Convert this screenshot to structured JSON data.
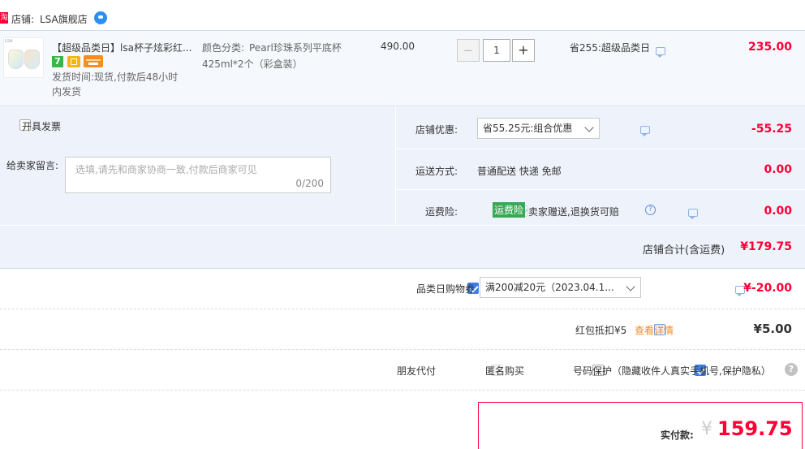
{
  "store": {
    "prefix": "店铺:",
    "name": "LSA旗舰店",
    "badge": "淘"
  },
  "item": {
    "title": "【超级品类日】lsa杯子炫彩红...",
    "sku_label": "颜色分类:",
    "sku_value_1": "Pearl珍珠系列平底杯",
    "sku_value_2": "425ml*2个（彩盒装）",
    "ship_time_1": "发货时间:现货,付款后48小时",
    "ship_time_2": "内发货",
    "price": "490.00",
    "qty": "1",
    "minus": "−",
    "plus": "+",
    "promo": "省255:超级品类日",
    "subtotal": "235.00",
    "thumb_logo": "LSA",
    "tag_seven": "7"
  },
  "invoice": {
    "label": "开具发票"
  },
  "remark": {
    "label": "给卖家留言:",
    "placeholder": "选填,请先和商家协商一致,付款后商家可见",
    "counter": "0/200"
  },
  "discount": {
    "label": "店铺优惠:",
    "value": "省55.25元:组合优惠",
    "amount": "-55.25"
  },
  "shipping": {
    "label": "运送方式:",
    "value": "普通配送 快递 免邮",
    "amount": "0.00"
  },
  "insurance": {
    "label": "运费险:",
    "tag": "运费险",
    "text": "卖家赠送,退换货可赔",
    "amount": "0.00",
    "help": "?"
  },
  "store_total": {
    "label": "店铺合计(含运费)",
    "amount": "¥179.75"
  },
  "coupon": {
    "label": "品类日购物券",
    "value": "满200减20元（2023.04.1...",
    "amount": "¥-20.00"
  },
  "redpacket": {
    "label": "红包抵扣¥5",
    "link": "查看详情",
    "amount": "¥5.00"
  },
  "options": {
    "friend_pay": "朋友代付",
    "anonymous": "匿名购买",
    "privacy": "号码保护（隐藏收件人真实手机号,保护隐私）",
    "help": "?"
  },
  "final": {
    "label": "实付款:",
    "currency": "¥",
    "amount": "159.75"
  },
  "colors": {
    "accent": "#ff0036",
    "blue": "#3d7eeb",
    "panel": "#eef3fb"
  }
}
